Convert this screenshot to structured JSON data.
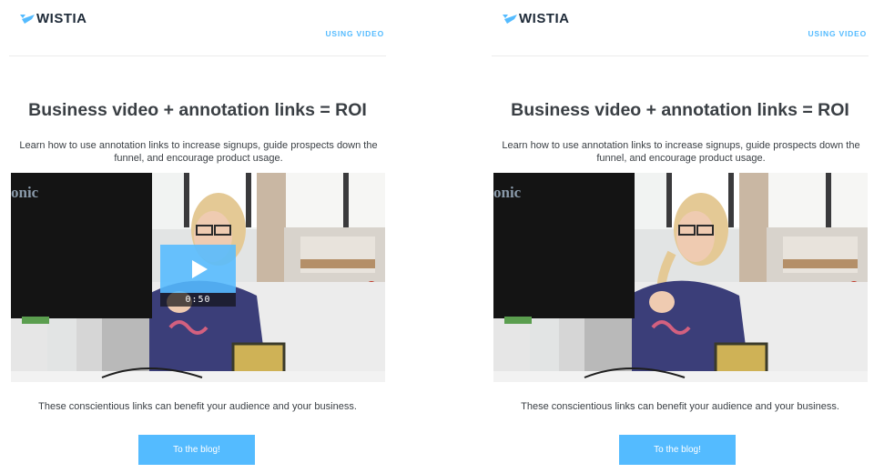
{
  "brand": {
    "name": "WISTIA",
    "accent_color": "#54bbff",
    "logo_icon": "wistia-logo-mark"
  },
  "nav": {
    "link_label": "USING VIDEO"
  },
  "email": {
    "title": "Business video + annotation links = ROI",
    "subtitle": "Learn how to use annotation links to increase signups, guide prospects down the funnel, and encourage product usage.",
    "caption": "These conscientious links can benefit your audience and your business.",
    "cta_label": "To the blog!"
  },
  "video": {
    "overlay_text": "onic",
    "duration": "0:50",
    "play_icon": "play-icon"
  }
}
